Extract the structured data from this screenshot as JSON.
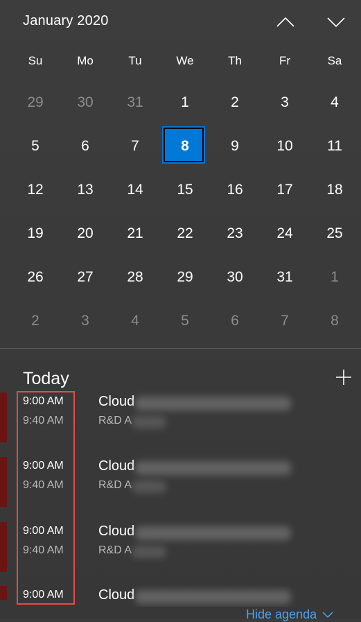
{
  "calendar": {
    "month_title": "January 2020",
    "weekdays": [
      "Su",
      "Mo",
      "Tu",
      "We",
      "Th",
      "Fr",
      "Sa"
    ],
    "days": [
      {
        "label": "29",
        "current": false
      },
      {
        "label": "30",
        "current": false
      },
      {
        "label": "31",
        "current": false
      },
      {
        "label": "1",
        "current": true
      },
      {
        "label": "2",
        "current": true
      },
      {
        "label": "3",
        "current": true
      },
      {
        "label": "4",
        "current": true
      },
      {
        "label": "5",
        "current": true
      },
      {
        "label": "6",
        "current": true
      },
      {
        "label": "7",
        "current": true
      },
      {
        "label": "8",
        "current": true,
        "today": true
      },
      {
        "label": "9",
        "current": true
      },
      {
        "label": "10",
        "current": true
      },
      {
        "label": "11",
        "current": true
      },
      {
        "label": "12",
        "current": true
      },
      {
        "label": "13",
        "current": true
      },
      {
        "label": "14",
        "current": true
      },
      {
        "label": "15",
        "current": true
      },
      {
        "label": "16",
        "current": true
      },
      {
        "label": "17",
        "current": true
      },
      {
        "label": "18",
        "current": true
      },
      {
        "label": "19",
        "current": true
      },
      {
        "label": "20",
        "current": true
      },
      {
        "label": "21",
        "current": true
      },
      {
        "label": "22",
        "current": true
      },
      {
        "label": "23",
        "current": true
      },
      {
        "label": "24",
        "current": true
      },
      {
        "label": "25",
        "current": true
      },
      {
        "label": "26",
        "current": true
      },
      {
        "label": "27",
        "current": true
      },
      {
        "label": "28",
        "current": true
      },
      {
        "label": "29",
        "current": true
      },
      {
        "label": "30",
        "current": true
      },
      {
        "label": "31",
        "current": true
      },
      {
        "label": "1",
        "current": false
      },
      {
        "label": "2",
        "current": false
      },
      {
        "label": "3",
        "current": false
      },
      {
        "label": "4",
        "current": false
      },
      {
        "label": "5",
        "current": false
      },
      {
        "label": "6",
        "current": false
      },
      {
        "label": "7",
        "current": false
      },
      {
        "label": "8",
        "current": false
      }
    ],
    "nav_icons": [
      "chevron-up-icon",
      "chevron-down-icon"
    ]
  },
  "agenda": {
    "title": "Today",
    "add_icon": "plus-icon",
    "events": [
      {
        "start": "9:00 AM",
        "end": "9:40 AM",
        "title": "Cloud",
        "location": "R&D A"
      },
      {
        "start": "9:00 AM",
        "end": "9:40 AM",
        "title": "Cloud",
        "location": "R&D A"
      },
      {
        "start": "9:00 AM",
        "end": "9:40 AM",
        "title": "Cloud",
        "location": "R&D A"
      },
      {
        "start": "9:00 AM",
        "end": "",
        "title": "Cloud",
        "location": ""
      }
    ],
    "hide_label": "Hide agenda"
  },
  "colors": {
    "background": "#3b3b3b",
    "accent": "#0078d7",
    "event_bar": "#6b1414",
    "highlight": "#e84a4a",
    "link": "#4aa3ef"
  }
}
